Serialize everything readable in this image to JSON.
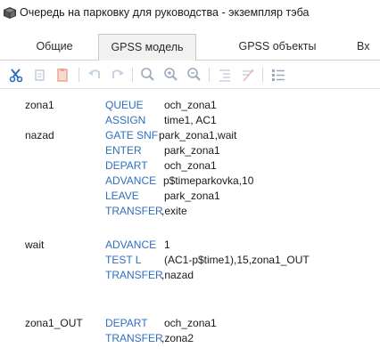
{
  "window": {
    "title": "Очередь на парковку для руководства - экземпляр тэба",
    "icon": "model-icon"
  },
  "tabs": [
    {
      "label": "Общие",
      "active": false
    },
    {
      "label": "GPSS модель",
      "active": true
    },
    {
      "label": "GPSS объекты",
      "active": false
    },
    {
      "label": "Вх",
      "active": false
    }
  ],
  "toolbar": {
    "buttons": [
      "cut-icon",
      "copy-icon",
      "paste-icon",
      "undo-icon",
      "redo-icon",
      "zoom-fit-icon",
      "zoom-in-icon",
      "zoom-out-icon",
      "indent-icon",
      "comment-icon",
      "list-icon"
    ],
    "accent": "#2f6fc0"
  },
  "code": {
    "colors": {
      "keyword": "#2f6fc0",
      "text": "#1a1a1a"
    },
    "lines": [
      {
        "label": "zona1",
        "block": "QUEUE",
        "operands": "och_zona1"
      },
      {
        "label": "",
        "block": "ASSIGN",
        "operands": "time1, AC1"
      },
      {
        "label": "nazad",
        "block": "GATE SNF",
        "operands": "park_zona1,wait"
      },
      {
        "label": "",
        "block": "ENTER",
        "operands": "park_zona1"
      },
      {
        "label": "",
        "block": "DEPART",
        "operands": "och_zona1"
      },
      {
        "label": "",
        "block": "ADVANCE",
        "operands": "p$timeparkovka,10"
      },
      {
        "label": "",
        "block": "LEAVE",
        "operands": "park_zona1"
      },
      {
        "label": "",
        "block": "TRANSFER",
        "operands": ",exite"
      },
      {
        "label": "wait",
        "block": "ADVANCE",
        "operands": "1"
      },
      {
        "label": "",
        "block": "TEST L",
        "operands": "(AC1-p$time1),15,zona1_OUT"
      },
      {
        "label": "",
        "block": "TRANSFER",
        "operands": ",nazad"
      },
      {
        "label": "zona1_OUT",
        "block": "DEPART",
        "operands": "och_zona1"
      },
      {
        "label": "",
        "block": "TRANSFER",
        "operands": ",zona2"
      }
    ]
  }
}
